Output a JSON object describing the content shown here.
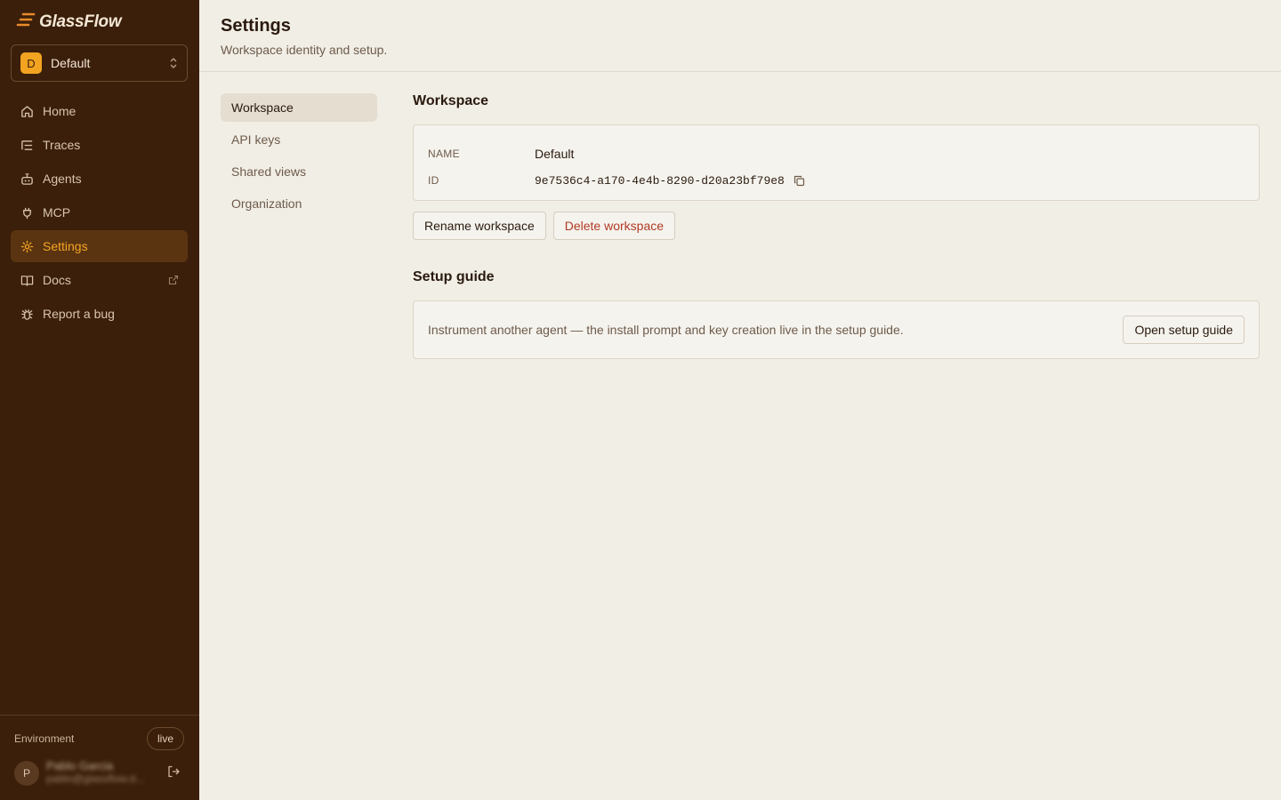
{
  "app": {
    "name": "GlassFlow"
  },
  "workspace_switcher": {
    "initial": "D",
    "name": "Default"
  },
  "nav": {
    "items": [
      {
        "label": "Home",
        "icon": "home-icon"
      },
      {
        "label": "Traces",
        "icon": "list-tree-icon"
      },
      {
        "label": "Agents",
        "icon": "bot-icon"
      },
      {
        "label": "MCP",
        "icon": "plug-icon"
      },
      {
        "label": "Settings",
        "icon": "gear-icon",
        "active": true
      },
      {
        "label": "Docs",
        "icon": "book-icon",
        "external": true
      },
      {
        "label": "Report a bug",
        "icon": "bug-icon"
      }
    ]
  },
  "footer": {
    "environment_label": "Environment",
    "environment_value": "live",
    "user_initial": "P",
    "user_name": "Pablo Garcia",
    "user_email": "pablo@glassflow.d..."
  },
  "header": {
    "title": "Settings",
    "subtitle": "Workspace identity and setup."
  },
  "subnav": {
    "items": [
      "Workspace",
      "API keys",
      "Shared views",
      "Organization"
    ],
    "active": "Workspace"
  },
  "workspace_section": {
    "title": "Workspace",
    "name_label": "NAME",
    "name_value": "Default",
    "id_label": "ID",
    "id_value": "9e7536c4-a170-4e4b-8290-d20a23bf79e8",
    "rename_label": "Rename workspace",
    "delete_label": "Delete workspace"
  },
  "setup_section": {
    "title": "Setup guide",
    "text": "Instrument another agent — the install prompt and key creation live in the setup guide.",
    "button_label": "Open setup guide"
  },
  "colors": {
    "sidebar_bg": "#3b1f0a",
    "accent": "#f5a524",
    "danger": "#b13a24",
    "page_bg": "#f1eee6"
  }
}
